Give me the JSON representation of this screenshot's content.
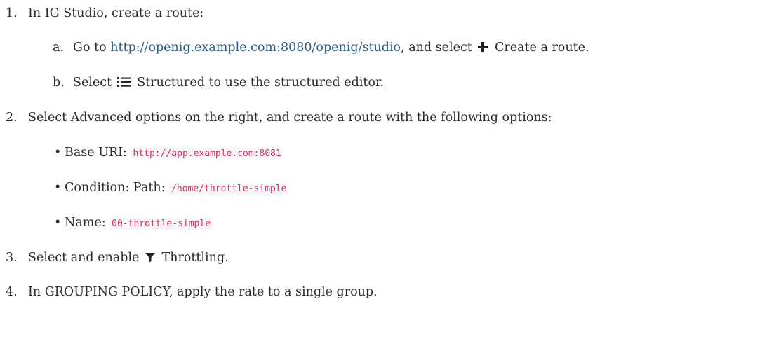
{
  "steps": [
    {
      "num": "1.",
      "text": "In IG Studio, create a route:"
    },
    {
      "num": "2.",
      "text": "Select Advanced options on the right, and create a route with the following options:"
    },
    {
      "num": "3.",
      "before": "Select and enable ",
      "icon": "filter-icon",
      "after": " Throttling."
    },
    {
      "num": "4.",
      "text": "In GROUPING POLICY, apply the rate to a single group."
    }
  ],
  "substeps": [
    {
      "letter": "a.",
      "before": "Go to ",
      "link": "http://openig.example.com:8080/openig/studio",
      "middle": ", and select ",
      "icon": "plus-icon",
      "after": " Create a route."
    },
    {
      "letter": "b.",
      "before": "Select ",
      "icon": "list-icon",
      "after": " Structured to use the structured editor."
    }
  ],
  "options": [
    {
      "label": "Base URI: ",
      "code": "http://app.example.com:8081"
    },
    {
      "label": "Condition: Path: ",
      "code": "/home/throttle-simple"
    },
    {
      "label": "Name: ",
      "code": "00-throttle-simple"
    }
  ]
}
